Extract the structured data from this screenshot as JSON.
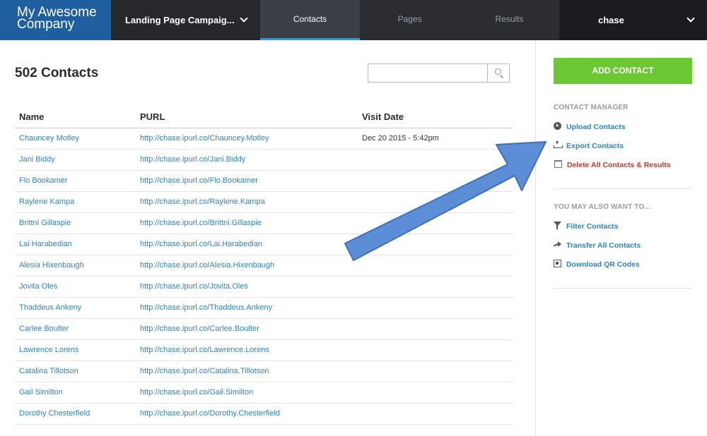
{
  "brand": {
    "line1": "My Awesome",
    "line2": "Company"
  },
  "nav": {
    "campaign": "Landing Page Campaig...",
    "tabs": [
      {
        "label": "Contacts",
        "active": true
      },
      {
        "label": "Pages",
        "active": false
      },
      {
        "label": "Results",
        "active": false
      }
    ],
    "user": "chase"
  },
  "main": {
    "title": "502 Contacts",
    "search": {
      "value": "",
      "placeholder": ""
    },
    "columns": [
      "Name",
      "PURL",
      "Visit Date"
    ],
    "rows": [
      {
        "name": "Chauncey Motley",
        "purl": "http://chase.ipurl.co/Chauncey.Motley",
        "visit": "Dec 20 2015 - 5:42pm"
      },
      {
        "name": "Jani Biddy",
        "purl": "http://chase.ipurl.co/Jani.Biddy",
        "visit": ""
      },
      {
        "name": "Flo Bookamer",
        "purl": "http://chase.ipurl.co/Flo.Bookamer",
        "visit": ""
      },
      {
        "name": "Raylene Kampa",
        "purl": "http://chase.ipurl.co/Raylene.Kampa",
        "visit": ""
      },
      {
        "name": "Brittni Gillaspie",
        "purl": "http://chase.ipurl.co/Brittni.Gillaspie",
        "visit": ""
      },
      {
        "name": "Lai Harabedian",
        "purl": "http://chase.ipurl.co/Lai.Harabedian",
        "visit": ""
      },
      {
        "name": "Alesia Hixenbaugh",
        "purl": "http://chase.ipurl.co/Alesia.Hixenbaugh",
        "visit": ""
      },
      {
        "name": "Jovita Oles",
        "purl": "http://chase.ipurl.co/Jovita.Oles",
        "visit": ""
      },
      {
        "name": "Thaddeus Ankeny",
        "purl": "http://chase.ipurl.co/Thaddeus.Ankeny",
        "visit": ""
      },
      {
        "name": "Carlee Boulter",
        "purl": "http://chase.ipurl.co/Carlee.Boulter",
        "visit": ""
      },
      {
        "name": "Lawrence Lorens",
        "purl": "http://chase.ipurl.co/Lawrence.Lorens",
        "visit": ""
      },
      {
        "name": "Catalina Tillotson",
        "purl": "http://chase.ipurl.co/Catalina.Tillotson",
        "visit": ""
      },
      {
        "name": "Gail Similton",
        "purl": "http://chase.ipurl.co/Gail.Similton",
        "visit": ""
      },
      {
        "name": "Dorothy Chesterfield",
        "purl": "http://chase.ipurl.co/Dorothy.Chesterfield",
        "visit": ""
      }
    ]
  },
  "sidebar": {
    "add_button": "ADD CONTACT",
    "manager_heading": "CONTACT MANAGER",
    "manager_items": [
      {
        "label": "Upload Contacts",
        "icon": "upload-icon"
      },
      {
        "label": "Export Contacts",
        "icon": "download-icon"
      },
      {
        "label": "Delete All Contacts & Results",
        "icon": "trash-icon"
      }
    ],
    "also_heading": "YOU MAY ALSO WANT TO...",
    "also_items": [
      {
        "label": "Filter Contacts",
        "icon": "filter-icon"
      },
      {
        "label": "Transfer All Contacts",
        "icon": "share-icon"
      },
      {
        "label": "Download QR Codes",
        "icon": "qr-code-icon"
      }
    ]
  },
  "colors": {
    "brand_blue": "#1f5fa0",
    "nav_dark": "#2b2d31",
    "link_blue": "#2e84c6",
    "add_green": "#6cc832",
    "danger_red": "#c0392b",
    "arrow_blue": "#5b8ed6"
  }
}
